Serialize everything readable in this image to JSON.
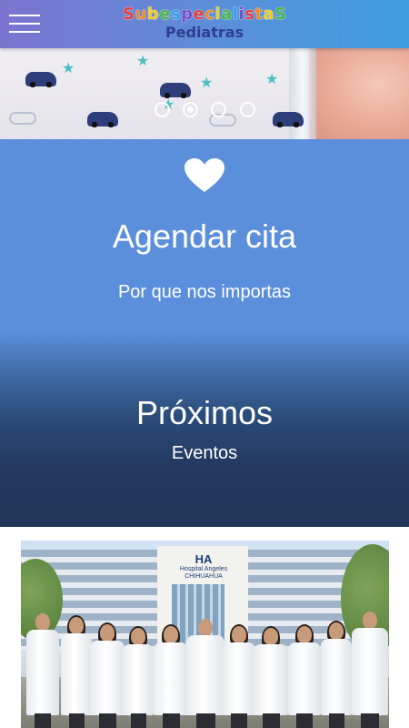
{
  "header": {
    "logo_title": "SubespecialistaS",
    "logo_title_colors": [
      "#e33b3b",
      "#f08a24",
      "#f2cf1f",
      "#47b649",
      "#2f9ee8",
      "#7a4cc9",
      "#e33b3b",
      "#f08a24",
      "#f2cf1f",
      "#47b649",
      "#2f9ee8",
      "#7a4cc9",
      "#e33b3b",
      "#f08a24",
      "#f2cf1f",
      "#47b649"
    ],
    "logo_subtitle": "Pediatras",
    "menu_icon": "hamburger-menu-icon"
  },
  "carousel": {
    "slide_count": 4,
    "active_index": 1
  },
  "cta": {
    "icon": "heart-icon",
    "title": "Agendar cita",
    "subtitle": "Por que nos importas"
  },
  "events": {
    "title": "Próximos",
    "subtitle": "Eventos"
  },
  "photo": {
    "hospital_name": "HA",
    "hospital_caption": "Hospital Angeles",
    "hospital_city": "CHIHUAHUA"
  },
  "colors": {
    "header_start": "#7b74cf",
    "header_end": "#3f9ee0",
    "cta_blue": "#5b8fdc",
    "events_dark": "#213558"
  }
}
